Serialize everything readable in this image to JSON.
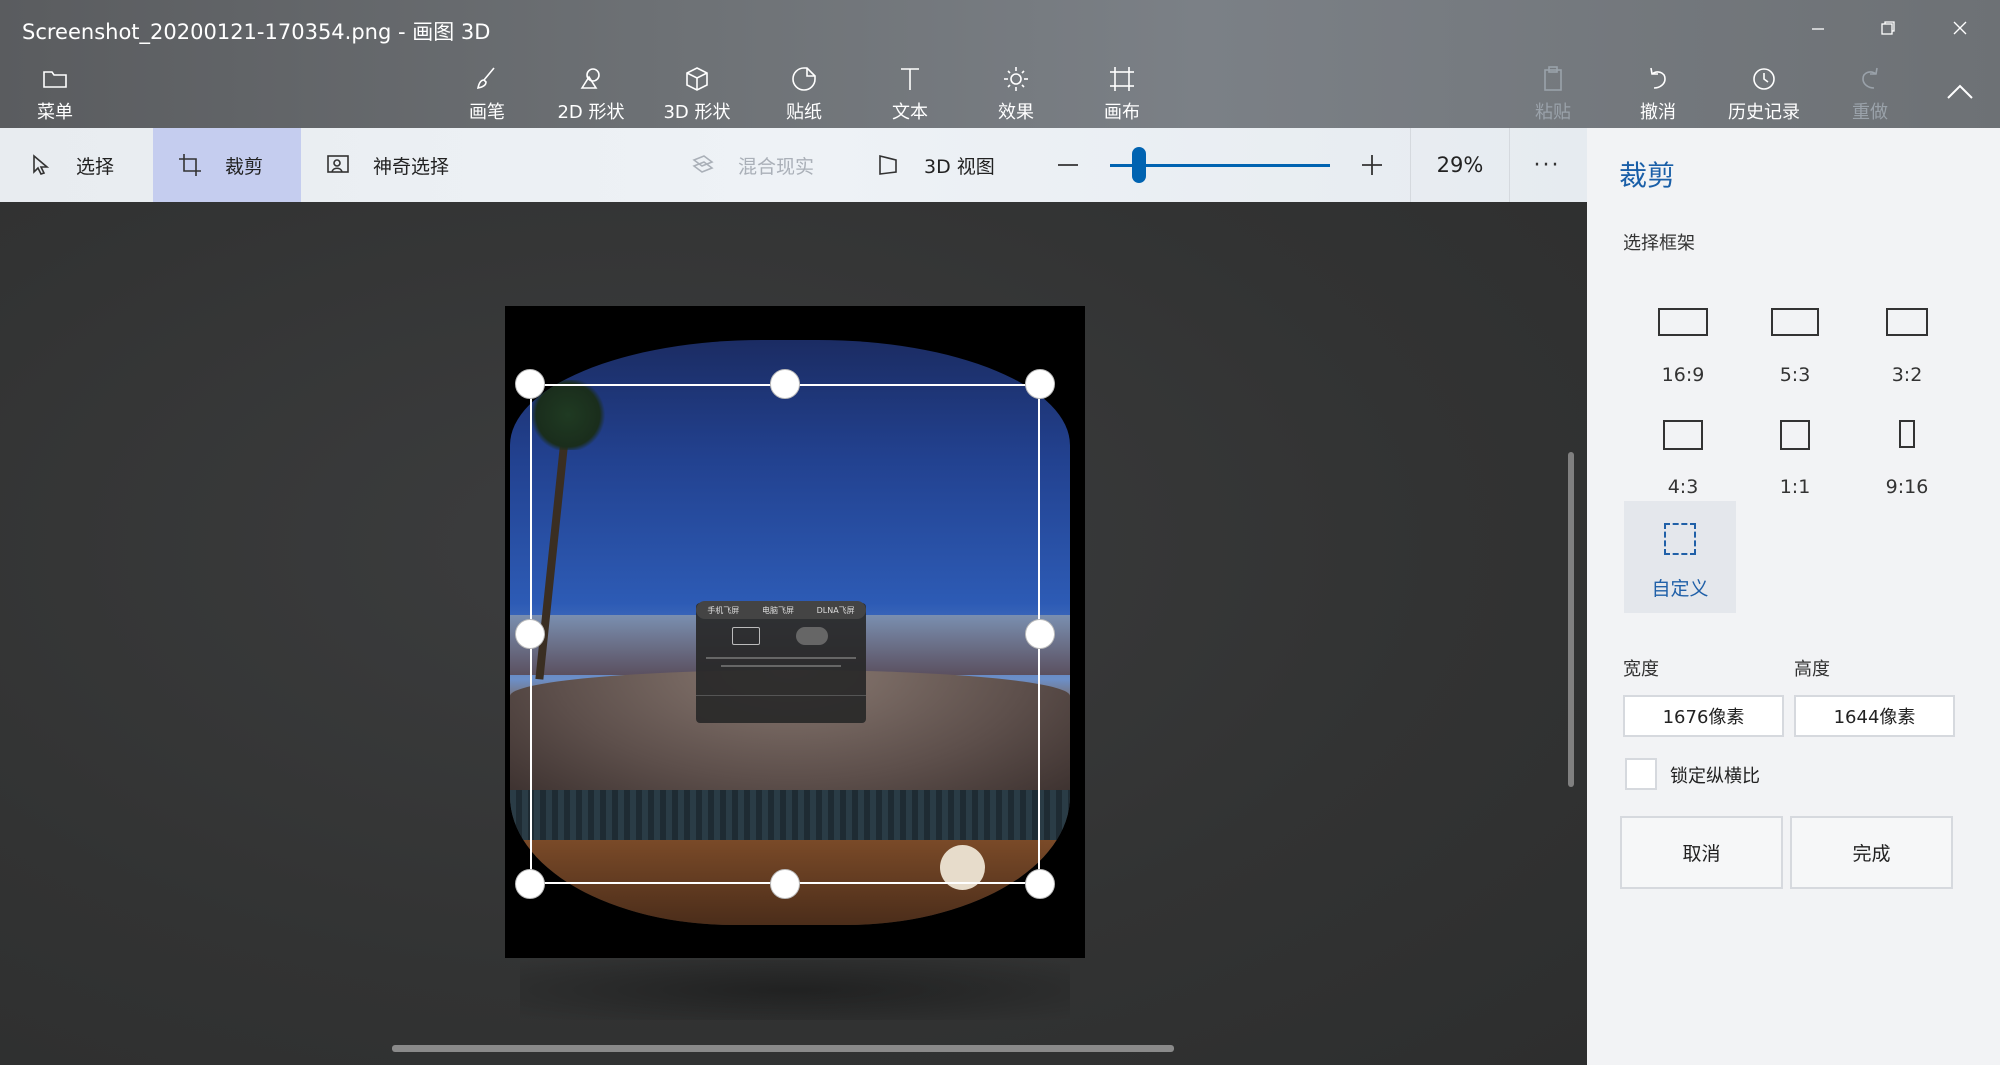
{
  "window": {
    "title": "Screenshot_20200121-170354.png - 画图 3D"
  },
  "ribbon": {
    "menu": "菜单",
    "tools": [
      {
        "label": "画笔",
        "icon": "brush-icon"
      },
      {
        "label": "2D 形状",
        "icon": "2d-shapes-icon"
      },
      {
        "label": "3D 形状",
        "icon": "3d-shapes-icon"
      },
      {
        "label": "贴纸",
        "icon": "stickers-icon"
      },
      {
        "label": "文本",
        "icon": "text-icon"
      },
      {
        "label": "效果",
        "icon": "effects-icon"
      },
      {
        "label": "画布",
        "icon": "canvas-icon"
      }
    ],
    "paste": "粘贴",
    "undo": "撤消",
    "history": "历史记录",
    "redo": "重做"
  },
  "toolbar": {
    "select": "选择",
    "crop": "裁剪",
    "magic_select": "神奇选择",
    "mixed_reality": "混合现实",
    "view_3d": "3D 视图",
    "zoom": "29%",
    "zoom_level": 0.1,
    "more": "···"
  },
  "panel": {
    "title": "裁剪",
    "section": "选择框架",
    "ratios": [
      "16:9",
      "5:3",
      "3:2",
      "4:3",
      "1:1",
      "9:16"
    ],
    "custom": "自定义",
    "width_label": "宽度",
    "height_label": "高度",
    "width_value": "1676像素",
    "height_value": "1644像素",
    "lock_label": "锁定纵横比",
    "cancel": "取消",
    "done": "完成"
  },
  "image": {
    "dialog_tabs": [
      "手机飞屏",
      "电脑飞屏",
      "DLNA飞屏"
    ]
  },
  "colors": {
    "accent": "#0063b1",
    "crop_tool_active": "#c5cdef",
    "panel_title": "#1a5fa8"
  }
}
